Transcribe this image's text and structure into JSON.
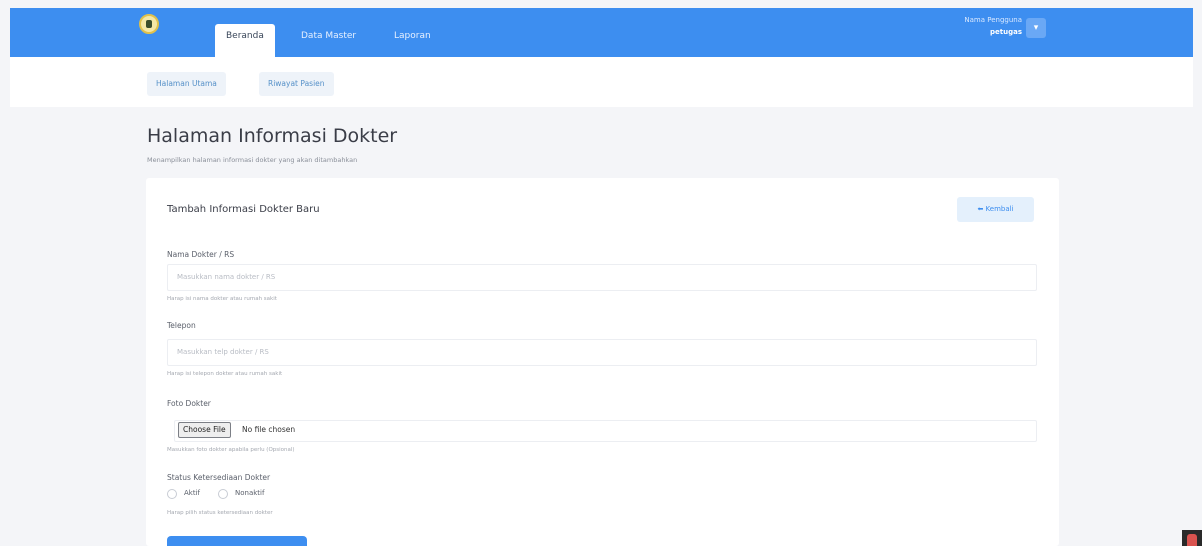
{
  "navbar": {
    "tabs": [
      {
        "label": "Beranda",
        "active": true
      },
      {
        "label": "Data Master",
        "active": false
      },
      {
        "label": "Laporan",
        "active": false
      }
    ],
    "user": {
      "name": "Nama Pengguna",
      "role": "petugas"
    },
    "user_button_icon": "chevron-down-icon",
    "accent_color": "#3d8ef0"
  },
  "subnav": {
    "items": [
      {
        "label": "Halaman Utama"
      },
      {
        "label": "Riwayat Pasien"
      }
    ]
  },
  "page": {
    "title": "Halaman Informasi Dokter",
    "subtitle": "Menampilkan halaman informasi dokter yang akan ditambahkan"
  },
  "form": {
    "title": "Tambah Informasi Dokter Baru",
    "back_label": "Kembali",
    "back_icon": "arrow-left-icon",
    "nama": {
      "label": "Nama Dokter / RS",
      "placeholder": "Masukkan nama dokter / RS",
      "hint": "Harap isi nama dokter atau rumah sakit"
    },
    "telepon": {
      "label": "Telepon",
      "placeholder": "Masukkan telp dokter / RS",
      "hint": "Harap isi telepon dokter atau rumah sakit"
    },
    "foto": {
      "label": "Foto Dokter",
      "button_label": "Choose File",
      "file_status": "No file chosen",
      "hint": "Masukkan foto dokter apabila perlu (Opsional)"
    },
    "status": {
      "label": "Status Ketersediaan Dokter",
      "options": [
        "Aktif",
        "Nonaktif"
      ],
      "hint": "Harap pilih status ketersediaan dokter"
    }
  }
}
